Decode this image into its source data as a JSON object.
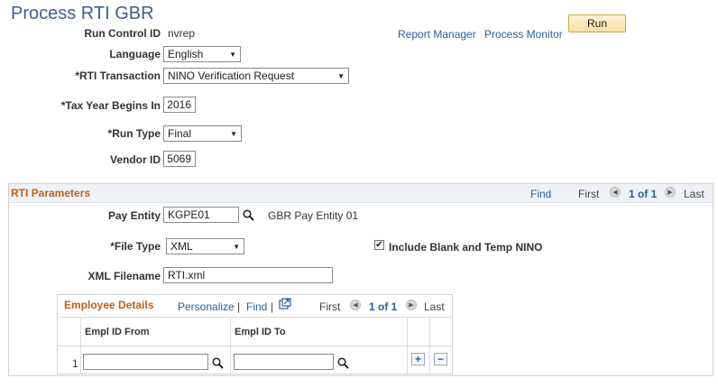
{
  "page": {
    "title": "Process RTI GBR"
  },
  "header": {
    "run_control_label": "Run Control ID",
    "run_control_value": "nvrep",
    "report_manager": "Report Manager",
    "process_monitor": "Process Monitor",
    "run_button": "Run"
  },
  "form": {
    "language_label": "Language",
    "language_value": "English",
    "rti_transaction_label": "*RTI Transaction",
    "rti_transaction_value": "NINO Verification Request",
    "tax_year_label": "*Tax Year Begins In",
    "tax_year_value": "2016",
    "run_type_label": "*Run Type",
    "run_type_value": "Final",
    "vendor_id_label": "Vendor ID",
    "vendor_id_value": "5069"
  },
  "rti_params": {
    "title": "RTI Parameters",
    "find": "Find",
    "first": "First",
    "counter": "1 of 1",
    "last": "Last",
    "pay_entity_label": "Pay Entity",
    "pay_entity_value": "KGPE01",
    "pay_entity_desc": "GBR Pay Entity 01",
    "file_type_label": "*File Type",
    "file_type_value": "XML",
    "include_blank_label": "Include Blank and Temp NINO",
    "include_blank_checked": true,
    "xml_filename_label": "XML Filename",
    "xml_filename_value": "RTI.xml"
  },
  "employee_details": {
    "title": "Employee Details",
    "personalize": "Personalize",
    "sep1": "|",
    "find": "Find",
    "sep2": "|",
    "first": "First",
    "counter": "1 of 1",
    "last": "Last",
    "columns": [
      "Empl ID From",
      "Empl ID To"
    ],
    "rows": [
      {
        "num": "1",
        "from": "",
        "to": ""
      }
    ]
  },
  "icons": {
    "dropdown": "chevron-down-icon",
    "lookup": "magnifier-icon",
    "prev": "circle-left-icon",
    "next": "circle-right-icon",
    "view_all": "new-window-icon",
    "add_row": "plus-icon",
    "delete_row": "minus-icon"
  },
  "colors": {
    "title": "#3d5f8f",
    "group_title": "#c05f1a",
    "link": "#2a5d9c",
    "run_button_bg": "#f6dfa4"
  }
}
